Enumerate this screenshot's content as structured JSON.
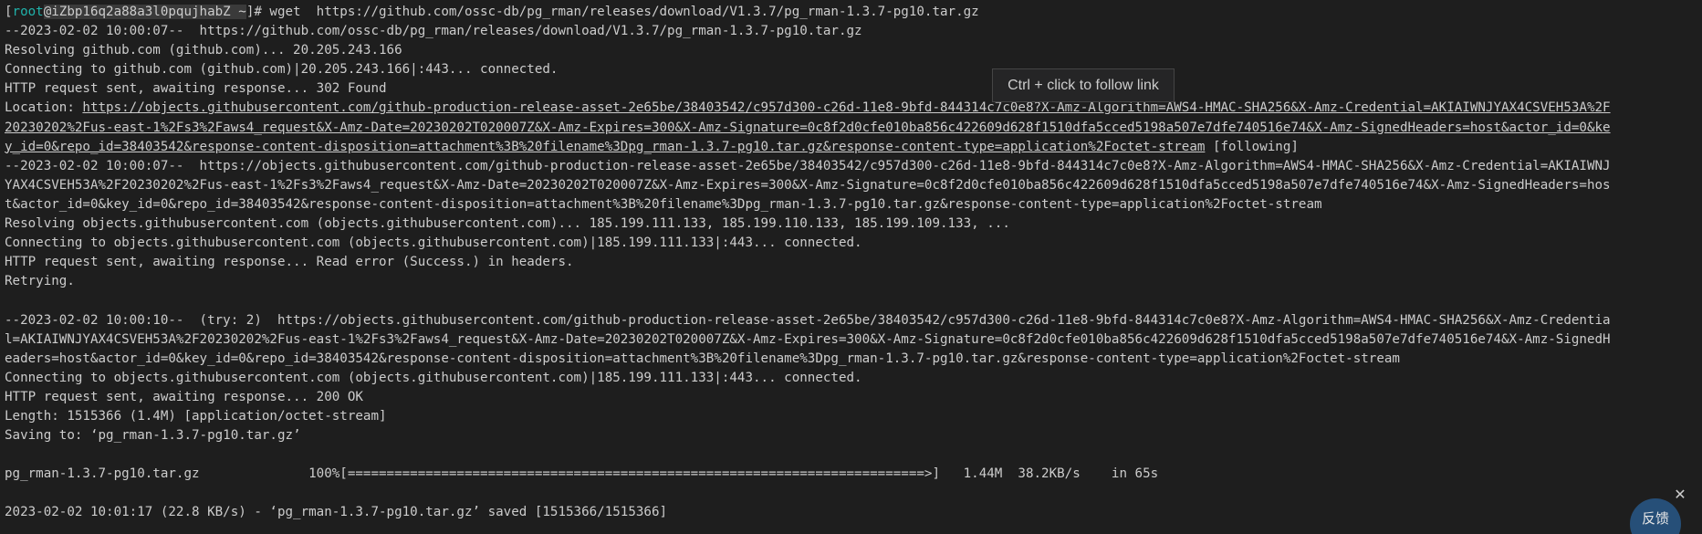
{
  "prompt": {
    "open_bracket": "[",
    "user": "root",
    "host": "@iZbp16q2a88a3l0pqujhabZ ~",
    "close_and_command": "]# wget  https://github.com/ossc-db/pg_rman/releases/download/V1.3.7/pg_rman-1.3.7-pg10.tar.gz"
  },
  "output": {
    "l02": "--2023-02-02 10:00:07--  https://github.com/ossc-db/pg_rman/releases/download/V1.3.7/pg_rman-1.3.7-pg10.tar.gz",
    "l03": "Resolving github.com (github.com)... 20.205.243.166",
    "l04": "Connecting to github.com (github.com)|20.205.243.166|:443... connected.",
    "l05": "HTTP request sent, awaiting response... 302 Found",
    "l06_label": "Location: ",
    "l06_link": "https://objects.githubusercontent.com/github-production-release-asset-2e65be/38403542/c957d300-c26d-11e8-9bfd-844314c7c0e8?X-Amz-Algorithm=AWS4-HMAC-SHA256&X-Amz-Credential=AKIAIWNJYAX4CSVEH53A%2F",
    "l07_link": "20230202%2Fus-east-1%2Fs3%2Faws4_request&X-Amz-Date=20230202T020007Z&X-Amz-Expires=300&X-Amz-Signature=0c8f2d0cfe010ba856c422609d628f1510dfa5cced5198a507e7dfe740516e74&X-Amz-SignedHeaders=host&actor_id=0&ke",
    "l08_link": "y_id=0&repo_id=38403542&response-content-disposition=attachment%3B%20filename%3Dpg_rman-1.3.7-pg10.tar.gz&response-content-type=application%2Foctet-stream",
    "l08_tail": " [following]",
    "l09": "--2023-02-02 10:00:07--  https://objects.githubusercontent.com/github-production-release-asset-2e65be/38403542/c957d300-c26d-11e8-9bfd-844314c7c0e8?X-Amz-Algorithm=AWS4-HMAC-SHA256&X-Amz-Credential=AKIAIWNJ",
    "l10": "YAX4CSVEH53A%2F20230202%2Fus-east-1%2Fs3%2Faws4_request&X-Amz-Date=20230202T020007Z&X-Amz-Expires=300&X-Amz-Signature=0c8f2d0cfe010ba856c422609d628f1510dfa5cced5198a507e7dfe740516e74&X-Amz-SignedHeaders=hos",
    "l11": "t&actor_id=0&key_id=0&repo_id=38403542&response-content-disposition=attachment%3B%20filename%3Dpg_rman-1.3.7-pg10.tar.gz&response-content-type=application%2Foctet-stream",
    "l12": "Resolving objects.githubusercontent.com (objects.githubusercontent.com)... 185.199.111.133, 185.199.110.133, 185.199.109.133, ...",
    "l13": "Connecting to objects.githubusercontent.com (objects.githubusercontent.com)|185.199.111.133|:443... connected.",
    "l14": "HTTP request sent, awaiting response... Read error (Success.) in headers.",
    "l15": "Retrying.",
    "l16": "",
    "l17": "--2023-02-02 10:00:10--  (try: 2)  https://objects.githubusercontent.com/github-production-release-asset-2e65be/38403542/c957d300-c26d-11e8-9bfd-844314c7c0e8?X-Amz-Algorithm=AWS4-HMAC-SHA256&X-Amz-Credentia",
    "l18": "l=AKIAIWNJYAX4CSVEH53A%2F20230202%2Fus-east-1%2Fs3%2Faws4_request&X-Amz-Date=20230202T020007Z&X-Amz-Expires=300&X-Amz-Signature=0c8f2d0cfe010ba856c422609d628f1510dfa5cced5198a507e7dfe740516e74&X-Amz-SignedH",
    "l19": "eaders=host&actor_id=0&key_id=0&repo_id=38403542&response-content-disposition=attachment%3B%20filename%3Dpg_rman-1.3.7-pg10.tar.gz&response-content-type=application%2Foctet-stream",
    "l20": "Connecting to objects.githubusercontent.com (objects.githubusercontent.com)|185.199.111.133|:443... connected.",
    "l21": "HTTP request sent, awaiting response... 200 OK",
    "l22": "Length: 1515366 (1.4M) [application/octet-stream]",
    "l23": "Saving to: ‘pg_rman-1.3.7-pg10.tar.gz’",
    "l24": "",
    "l25": "pg_rman-1.3.7-pg10.tar.gz              100%[==========================================================================>]   1.44M  38.2KB/s    in 65s",
    "l26": "",
    "l27": "2023-02-02 10:01:17 (22.8 KB/s) - ‘pg_rman-1.3.7-pg10.tar.gz’ saved [1515366/1515366]"
  },
  "tooltip": {
    "text": "Ctrl + click to follow link"
  },
  "feedback": {
    "label": "反馈"
  },
  "close": {
    "symbol": "✕"
  }
}
